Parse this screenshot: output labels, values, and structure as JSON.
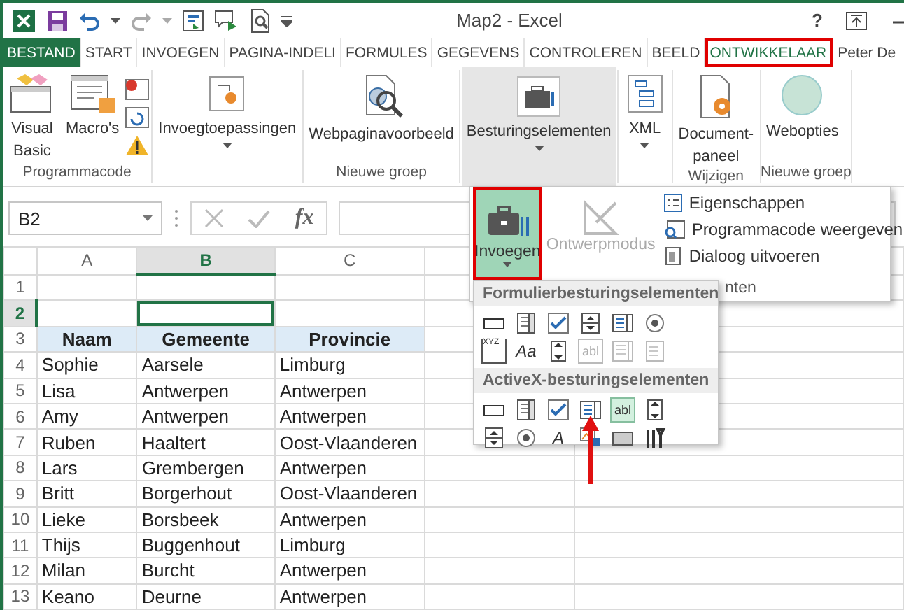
{
  "window": {
    "title": "Map2 - Excel",
    "help": "?"
  },
  "tabs": [
    {
      "label": "BESTAND",
      "kind": "file",
      "selected": false,
      "annotated": false
    },
    {
      "label": "START",
      "kind": "tab",
      "selected": false,
      "annotated": false
    },
    {
      "label": "INVOEGEN",
      "kind": "tab",
      "selected": false,
      "annotated": false
    },
    {
      "label": "PAGINA-INDELI",
      "kind": "tab",
      "selected": false,
      "annotated": false
    },
    {
      "label": "FORMULES",
      "kind": "tab",
      "selected": false,
      "annotated": false
    },
    {
      "label": "GEGEVENS",
      "kind": "tab",
      "selected": false,
      "annotated": false
    },
    {
      "label": "CONTROLEREN",
      "kind": "tab",
      "selected": false,
      "annotated": false
    },
    {
      "label": "BEELD",
      "kind": "tab",
      "selected": false,
      "annotated": false
    },
    {
      "label": "ONTWIKKELAAR",
      "kind": "tab",
      "selected": true,
      "annotated": true
    }
  ],
  "user": "Peter De",
  "ribbon": {
    "groups": [
      {
        "label": "Programmacode",
        "buttons": [
          {
            "kind": "large",
            "label": "Visual Basic",
            "dropdown": false,
            "expanded": false
          },
          {
            "kind": "large",
            "label": "Macro's",
            "dropdown": false,
            "expanded": false
          },
          {
            "kind": "icon_stack"
          }
        ]
      },
      {
        "buttons": [
          {
            "kind": "large",
            "label": "Invoegtoepassingen",
            "dropdown": true,
            "expanded": false
          }
        ]
      },
      {
        "label": "Nieuwe groep",
        "buttons": [
          {
            "kind": "large",
            "label": "Webpaginavoorbeeld",
            "dropdown": false,
            "expanded": false
          }
        ]
      },
      {
        "buttons": [
          {
            "kind": "large",
            "label": "Besturingselementen",
            "dropdown": true,
            "expanded": true
          }
        ]
      },
      {
        "buttons": [
          {
            "kind": "large",
            "label": "XML",
            "dropdown": true,
            "expanded": false
          }
        ]
      },
      {
        "label": "Wijzigen",
        "buttons": [
          {
            "kind": "large",
            "label": "Document-paneel",
            "dropdown": false,
            "expanded": false
          }
        ]
      },
      {
        "label": "Nieuwe groep",
        "buttons": [
          {
            "kind": "large",
            "label": "Webopties",
            "dropdown": false,
            "expanded": false
          }
        ]
      }
    ]
  },
  "formula_bar": {
    "name_box": "B2",
    "function_label": "fx"
  },
  "sheet": {
    "columns": [
      {
        "label": "A",
        "selected": false
      },
      {
        "label": "B",
        "selected": true
      },
      {
        "label": "C",
        "selected": false
      }
    ],
    "rows": [
      {
        "number": "1",
        "kind": "empty",
        "selected": false
      },
      {
        "number": "2",
        "kind": "empty",
        "selected": true
      },
      {
        "number": "3",
        "kind": "header",
        "selected": false,
        "cells": [
          "Naam",
          "Gemeente",
          "Provincie"
        ]
      },
      {
        "number": "4",
        "kind": "data",
        "selected": false,
        "cells": [
          "Sophie",
          "Aarsele",
          "Limburg"
        ]
      },
      {
        "number": "5",
        "kind": "data",
        "selected": false,
        "cells": [
          "Lisa",
          "Antwerpen",
          "Antwerpen"
        ]
      },
      {
        "number": "6",
        "kind": "data",
        "selected": false,
        "cells": [
          "Amy",
          "Antwerpen",
          "Antwerpen"
        ]
      },
      {
        "number": "7",
        "kind": "data",
        "selected": false,
        "cells": [
          "Ruben",
          "Haaltert",
          "Oost-Vlaanderen"
        ]
      },
      {
        "number": "8",
        "kind": "data",
        "selected": false,
        "cells": [
          "Lars",
          "Grembergen",
          "Antwerpen"
        ]
      },
      {
        "number": "9",
        "kind": "data",
        "selected": false,
        "cells": [
          "Britt",
          "Borgerhout",
          "Oost-Vlaanderen"
        ]
      },
      {
        "number": "10",
        "kind": "data",
        "selected": false,
        "cells": [
          "Lieke",
          "Borsbeek",
          "Antwerpen"
        ]
      },
      {
        "number": "11",
        "kind": "data",
        "selected": false,
        "cells": [
          "Thijs",
          "Buggenhout",
          "Limburg"
        ]
      },
      {
        "number": "12",
        "kind": "data",
        "selected": false,
        "cells": [
          "Milan",
          "Burcht",
          "Antwerpen"
        ]
      },
      {
        "number": "13",
        "kind": "data",
        "selected": false,
        "cells": [
          "Keano",
          "Deurne",
          "Antwerpen"
        ]
      }
    ]
  },
  "popup": {
    "insert_button": {
      "label": "Invoegen",
      "selected": true,
      "annotated": true
    },
    "design_mode": {
      "label": "Ontwerpmodus",
      "disabled": true
    },
    "commands": [
      {
        "label": "Eigenschappen"
      },
      {
        "label": "Programmacode weergeven"
      },
      {
        "label": "Dialoog uitvoeren"
      }
    ],
    "group_label": "nten"
  },
  "gallery": {
    "sections": [
      {
        "title": "Formulierbesturingselementen",
        "controls": [
          {
            "kind": "button",
            "disabled": false,
            "selected": false
          },
          {
            "kind": "combo",
            "disabled": false,
            "selected": false
          },
          {
            "kind": "checkbox",
            "disabled": false,
            "selected": false
          },
          {
            "kind": "spin",
            "disabled": false,
            "selected": false
          },
          {
            "kind": "list",
            "disabled": false,
            "selected": false
          },
          {
            "kind": "option",
            "disabled": false,
            "selected": false
          },
          {
            "kind": "group",
            "glyph": "XYZ",
            "disabled": false,
            "selected": false
          },
          {
            "kind": "label",
            "glyph": "Aa",
            "disabled": false,
            "selected": false
          },
          {
            "kind": "scroll",
            "disabled": false,
            "selected": false
          },
          {
            "kind": "textfield",
            "glyph": "abl",
            "disabled": true,
            "selected": false
          },
          {
            "kind": "combolist",
            "disabled": true,
            "selected": false
          },
          {
            "kind": "combodrop",
            "disabled": true,
            "selected": false
          }
        ]
      },
      {
        "title": "ActiveX-besturingselementen",
        "controls": [
          {
            "kind": "button",
            "disabled": false,
            "selected": false
          },
          {
            "kind": "combo",
            "disabled": false,
            "selected": false
          },
          {
            "kind": "checkbox",
            "disabled": false,
            "selected": false
          },
          {
            "kind": "list",
            "disabled": false,
            "selected": false
          },
          {
            "kind": "textfield",
            "glyph": "abl",
            "disabled": false,
            "selected": true
          },
          {
            "kind": "scroll",
            "disabled": false,
            "selected": false
          },
          {
            "kind": "spin",
            "disabled": false,
            "selected": false
          },
          {
            "kind": "option",
            "disabled": false,
            "selected": false
          },
          {
            "kind": "label",
            "glyph": "A",
            "disabled": false,
            "selected": false
          },
          {
            "kind": "image",
            "disabled": false,
            "selected": false
          },
          {
            "kind": "toggle",
            "disabled": false,
            "selected": false
          },
          {
            "kind": "more",
            "disabled": false,
            "selected": false
          }
        ]
      }
    ]
  }
}
